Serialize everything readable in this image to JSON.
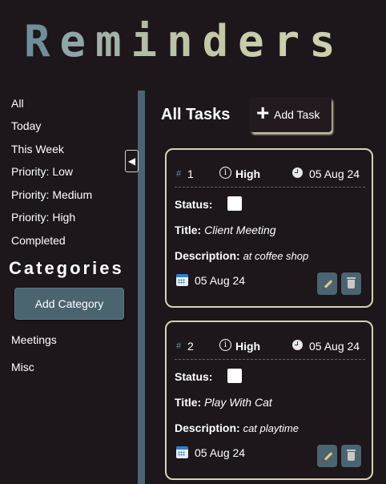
{
  "app": {
    "title": "Reminders",
    "title_colors": [
      "#6f8e9a",
      "#8fa6a8",
      "#a3b2a6",
      "#b3bca5",
      "#bcc3a6",
      "#c3c8a7",
      "#c8cca9",
      "#cbceaa",
      "#cdd0ab"
    ]
  },
  "sidebar": {
    "collapse_glyph": "◀",
    "items": [
      {
        "label": "All"
      },
      {
        "label": "Today"
      },
      {
        "label": "This Week"
      },
      {
        "label": "Priority: Low"
      },
      {
        "label": "Priority: Medium"
      },
      {
        "label": "Priority: High"
      },
      {
        "label": "Completed"
      }
    ],
    "categories_heading": "Categories",
    "add_category_label": "Add Category",
    "categories": [
      {
        "label": "Meetings"
      },
      {
        "label": "Misc"
      }
    ]
  },
  "main": {
    "title": "All Tasks",
    "add_task_icon": "+",
    "add_task_label": "Add Task",
    "tasks": [
      {
        "hash": "#",
        "number": "1",
        "priority_icon": "i",
        "priority": "High",
        "date": "05 Aug 24",
        "status_label": "Status:",
        "title_label": "Title:",
        "title": "Client Meeting",
        "description_label": "Description:",
        "description": "at coffee shop",
        "due_date": "05 Aug 24",
        "completed": false
      },
      {
        "hash": "#",
        "number": "2",
        "priority_icon": "i",
        "priority": "High",
        "date": "05 Aug 24",
        "status_label": "Status:",
        "title_label": "Title:",
        "title": "Play With Cat",
        "description_label": "Description:",
        "description": "cat playtime",
        "due_date": "05 Aug 24",
        "completed": false
      }
    ]
  },
  "colors": {
    "background": "#1d161b",
    "accent": "#4a6470",
    "card_border": "#d6d3b8"
  }
}
